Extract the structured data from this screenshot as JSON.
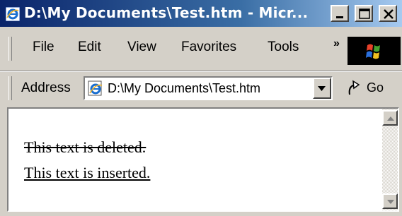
{
  "window": {
    "title": "D:\\My Documents\\Test.htm - Micr...",
    "app_icon": "ie-icon",
    "controls": [
      "minimize-icon",
      "maximize-icon",
      "close-icon"
    ]
  },
  "menu": {
    "items": [
      "File",
      "Edit",
      "View",
      "Favorites",
      "Tools"
    ],
    "overflow": "»",
    "logo": "windows-logo-icon"
  },
  "address": {
    "label": "Address",
    "value": "D:\\My Documents\\Test.htm",
    "page_icon": "ie-page-icon",
    "go_label": "Go",
    "go_icon": "go-arrow-icon"
  },
  "page": {
    "deleted_text": "This text is deleted.",
    "inserted_text": "This text is inserted."
  },
  "colors": {
    "titlebar_start": "#0a246a",
    "titlebar_end": "#a6caf0",
    "chrome": "#d4d0c8",
    "content_bg": "#ffffff"
  }
}
